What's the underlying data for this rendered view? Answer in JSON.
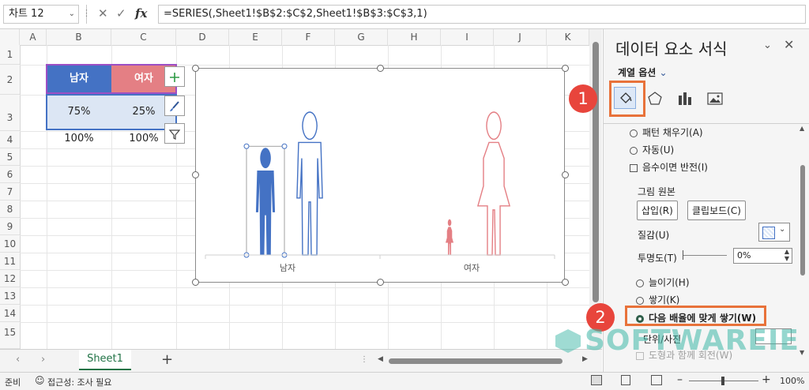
{
  "formula_bar": {
    "name_box": "차트 12",
    "fx_label": "fx",
    "formula": "=SERIES(,Sheet1!$B$2:$C$2,Sheet1!$B$3:$C$3,1)"
  },
  "grid": {
    "columns": [
      "A",
      "B",
      "C",
      "D",
      "E",
      "F",
      "G",
      "H",
      "I",
      "J",
      "K"
    ],
    "rows": [
      "1",
      "2",
      "3",
      "4",
      "5",
      "6",
      "7",
      "8",
      "9",
      "10",
      "11",
      "12",
      "13",
      "14",
      "15"
    ]
  },
  "cells": {
    "b2": "남자",
    "c2": "여자",
    "b3": "75%",
    "c3": "25%",
    "b4": "100%",
    "c4": "100%"
  },
  "chart_data": {
    "type": "bar",
    "categories": [
      "남자",
      "여자"
    ],
    "series": [
      {
        "values": [
          75,
          25
        ]
      },
      {
        "values": [
          100,
          100
        ]
      }
    ],
    "ylim": [
      0,
      100
    ],
    "colors": {
      "male": "#4472c4",
      "female": "#e47f84"
    }
  },
  "sheet_tab": "Sheet1",
  "status_bar": {
    "ready": "준비",
    "accessibility": "접근성: 조사 필요",
    "zoom": "100%"
  },
  "pane": {
    "title": "데이터 요소 서식",
    "series_options": "계열 옵션",
    "fill_options": [
      {
        "label": "패턴 채우기(A)",
        "type": "radio"
      },
      {
        "label": "자동(U)",
        "type": "radio"
      },
      {
        "label": "음수이면 반전(I)",
        "type": "checkbox"
      }
    ],
    "picture_source": "그림 원본",
    "insert_button": "삽입(R)",
    "clipboard_button": "클립보드(C)",
    "texture_label": "질감(U)",
    "transparency_label": "투명도(T)",
    "transparency_value": "0%",
    "stack_options": [
      "늘이기(H)",
      "쌓기(K)",
      "다음 배율에 맞게 쌓기(W)"
    ],
    "units_label": "단위/사진",
    "rotate_label": "도형과 함께 회전(W)"
  },
  "callouts": [
    "1",
    "2"
  ],
  "watermark": "SOFTWAREIE",
  "colors": {
    "accent_green": "#217346",
    "callout_red": "#e8453c",
    "highlight_orange": "#e8723a"
  }
}
